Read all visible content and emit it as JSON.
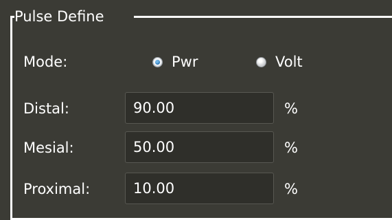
{
  "group": {
    "title": "Pulse Define"
  },
  "mode": {
    "label": "Mode:",
    "options": [
      {
        "label": "Pwr",
        "selected": true
      },
      {
        "label": "Volt",
        "selected": false
      }
    ]
  },
  "fields": [
    {
      "label": "Distal:",
      "value": "90.00",
      "unit": "%"
    },
    {
      "label": "Mesial:",
      "value": "50.00",
      "unit": "%"
    },
    {
      "label": "Proximal:",
      "value": "10.00",
      "unit": "%"
    }
  ],
  "colors": {
    "panel_background": "#3b3b35",
    "field_background": "#2f2f2a",
    "text": "#ffffff",
    "radio_selected_accent": "#1f6fb3"
  }
}
